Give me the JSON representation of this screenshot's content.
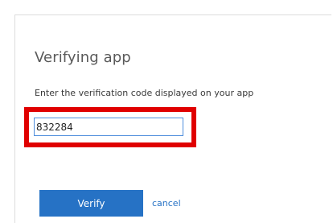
{
  "dialog": {
    "title": "Verifying app",
    "instruction": "Enter the verification code displayed on your app",
    "code_input": {
      "value": "832284",
      "placeholder": ""
    },
    "verify_label": "Verify",
    "cancel_label": "cancel"
  },
  "colors": {
    "accent": "#2672c5",
    "highlight": "#e00000",
    "input_border": "#4f8edc"
  }
}
